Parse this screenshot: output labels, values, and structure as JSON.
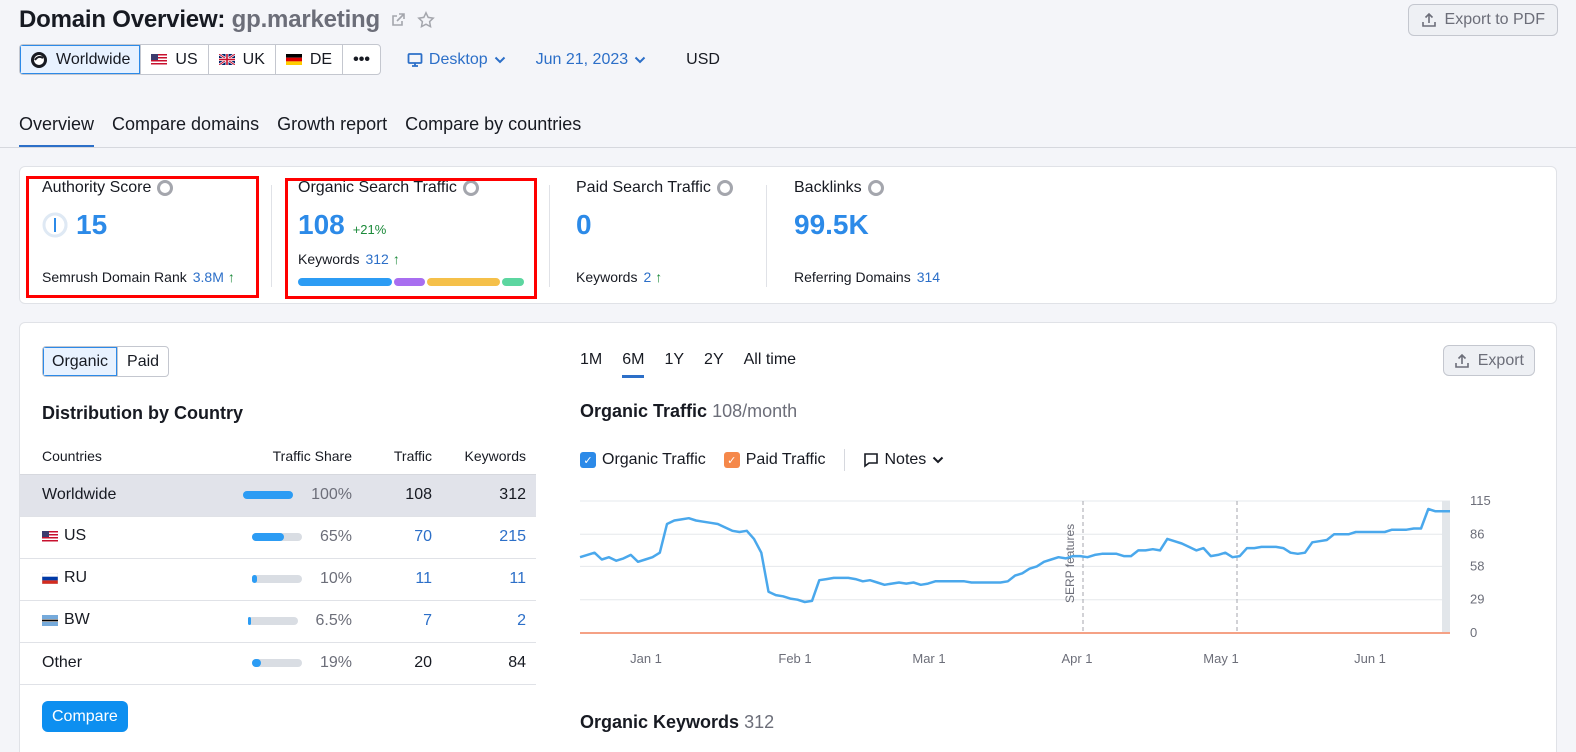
{
  "header": {
    "title_prefix": "Domain Overview:",
    "domain": "gp.marketing",
    "export_pdf": "Export to PDF",
    "databases": [
      {
        "label": "Worldwide",
        "flag": "globe-icon",
        "active": true
      },
      {
        "label": "US",
        "flag": "us-flag-icon"
      },
      {
        "label": "UK",
        "flag": "uk-flag-icon"
      },
      {
        "label": "DE",
        "flag": "de-flag-icon"
      },
      {
        "label": "•••",
        "flag": ""
      }
    ],
    "device": "Desktop",
    "date": "Jun 21, 2023",
    "currency": "USD"
  },
  "tabs": [
    "Overview",
    "Compare domains",
    "Growth report",
    "Compare by countries"
  ],
  "summary": {
    "authority": {
      "label": "Authority Score",
      "value": "15",
      "sub_label": "Semrush Domain Rank",
      "sub_value": "3.8M"
    },
    "organic": {
      "label": "Organic Search Traffic",
      "value": "108",
      "delta": "+21%",
      "sub_label": "Keywords",
      "sub_value": "312"
    },
    "paid": {
      "label": "Paid Search Traffic",
      "value": "0",
      "sub_label": "Keywords",
      "sub_value": "2"
    },
    "backlinks": {
      "label": "Backlinks",
      "value": "99.5K",
      "sub_label": "Referring Domains",
      "sub_value": "314"
    }
  },
  "main": {
    "toggle": [
      "Organic",
      "Paid"
    ],
    "distribution_title": "Distribution by Country",
    "columns": [
      "Countries",
      "Traffic Share",
      "Traffic",
      "Keywords"
    ],
    "rows": [
      {
        "country": "Worldwide",
        "flag": "",
        "share": "100%",
        "share_fraction": 1.0,
        "traffic": "108",
        "keywords": "312"
      },
      {
        "country": "US",
        "flag": "us-flag-icon",
        "share": "65%",
        "share_fraction": 0.65,
        "traffic": "70",
        "keywords": "215"
      },
      {
        "country": "RU",
        "flag": "ru-flag-icon",
        "share": "10%",
        "share_fraction": 0.1,
        "traffic": "11",
        "keywords": "11"
      },
      {
        "country": "BW",
        "flag": "bw-flag-icon",
        "share": "6.5%",
        "share_fraction": 0.065,
        "traffic": "7",
        "keywords": "2"
      },
      {
        "country": "Other",
        "flag": "",
        "share": "19%",
        "share_fraction": 0.19,
        "traffic": "20",
        "keywords": "84"
      }
    ],
    "compare_button": "Compare",
    "ranges": [
      "1M",
      "6M",
      "1Y",
      "2Y",
      "All time"
    ],
    "active_range": "6M",
    "export": "Export",
    "traffic_title": "Organic Traffic",
    "traffic_sub": "108/month",
    "legend": {
      "organic": "Organic Traffic",
      "paid": "Paid Traffic",
      "notes": "Notes"
    },
    "keywords_title": "Organic Keywords",
    "keywords_sub": "312"
  },
  "colors": {
    "accent": "#2c8ae8",
    "organic_line": "#4aa8ec",
    "paid_line": "#f5a185",
    "highlight": "#ff0000"
  },
  "chart_data": {
    "type": "line",
    "x_ticks": [
      "Jan 1",
      "Feb 1",
      "Mar 1",
      "Apr 1",
      "May 1",
      "Jun 1"
    ],
    "y_ticks": [
      "115",
      "86",
      "58",
      "29",
      "0"
    ],
    "ylim": [
      0,
      115
    ],
    "annotation": "SERP features",
    "series": [
      {
        "name": "Organic Traffic",
        "values": [
          66,
          68,
          70,
          64,
          66,
          63,
          65,
          68,
          62,
          64,
          66,
          70,
          95,
          98,
          99,
          100,
          98,
          97,
          96,
          95,
          92,
          89,
          88,
          89,
          82,
          70,
          36,
          33,
          32,
          30,
          29,
          27,
          28,
          46,
          47,
          48,
          48,
          48,
          47,
          45,
          46,
          44,
          42,
          43,
          44,
          43,
          44,
          42,
          43,
          45,
          45,
          45,
          45,
          45,
          44,
          44,
          44,
          44,
          44,
          45,
          50,
          52,
          56,
          58,
          62,
          64,
          66,
          65,
          67,
          67,
          66,
          68,
          69,
          69,
          69,
          67,
          67,
          72,
          72,
          73,
          72,
          82,
          80,
          78,
          75,
          72,
          74,
          67,
          68,
          70,
          66,
          67,
          74,
          74,
          75,
          75,
          75,
          74,
          70,
          69,
          70,
          79,
          80,
          81,
          86,
          86,
          86,
          88,
          88,
          88,
          88,
          88,
          90,
          90,
          90,
          91,
          91,
          108,
          106,
          106,
          106
        ]
      },
      {
        "name": "Paid Traffic",
        "values": [
          0,
          0
        ]
      }
    ]
  }
}
